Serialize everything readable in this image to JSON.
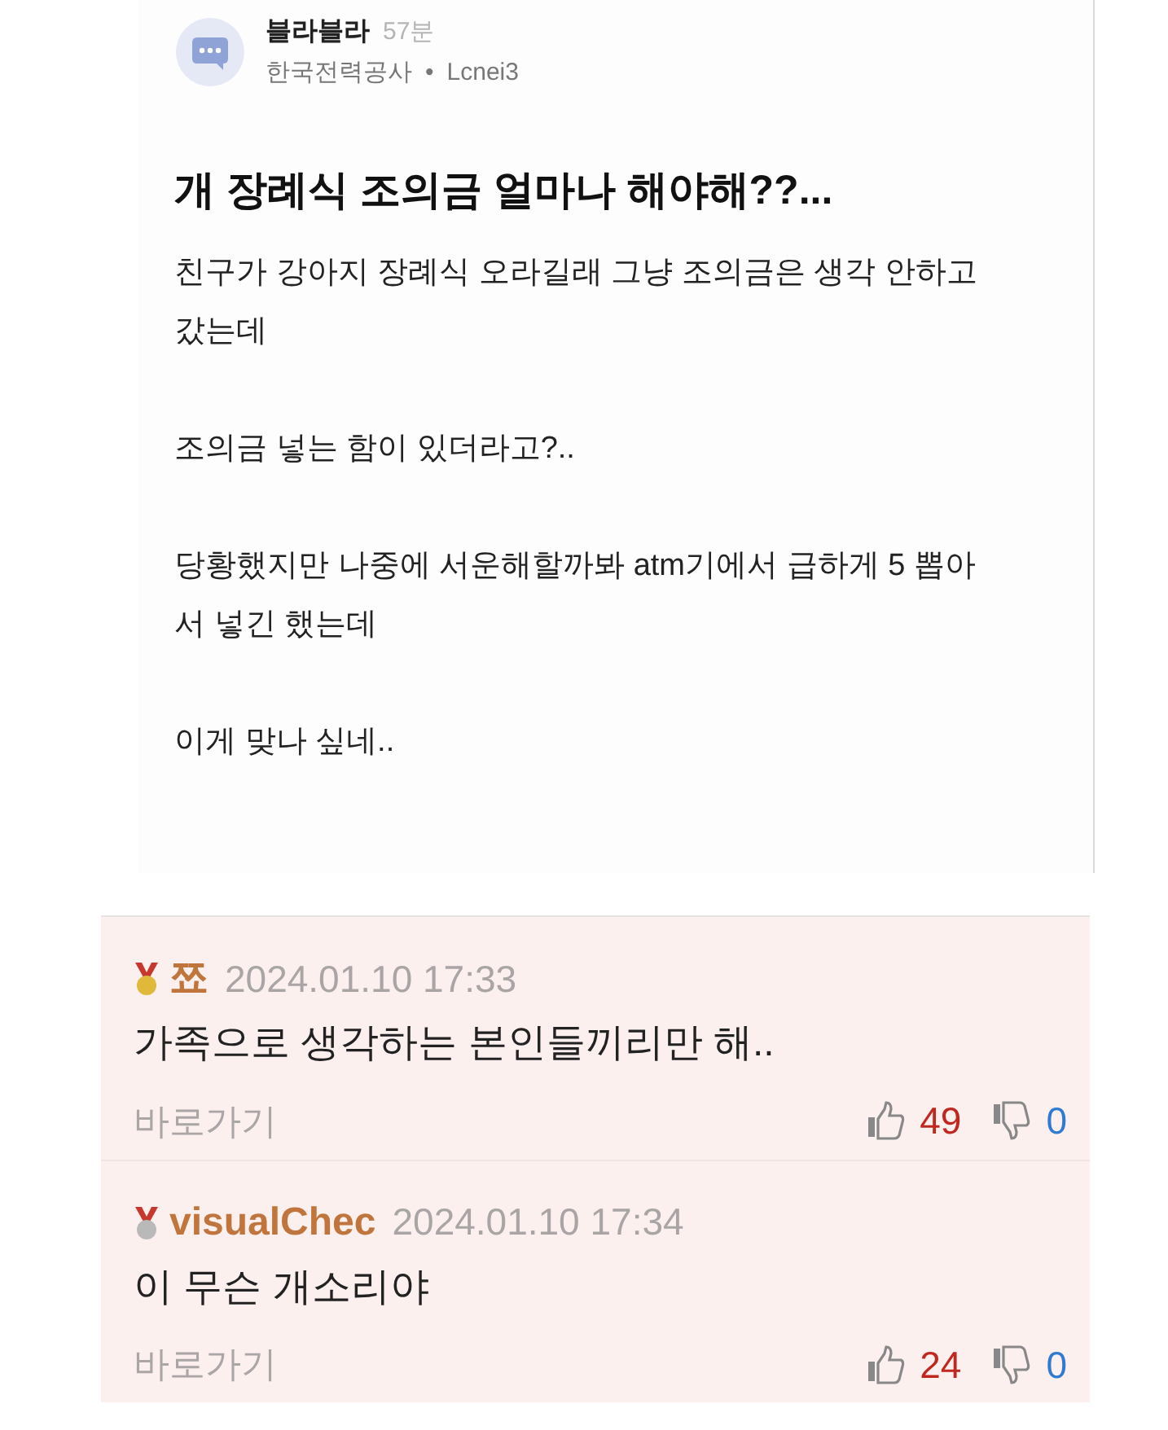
{
  "post": {
    "author": "블라블라",
    "time": "57분",
    "company": "한국전력공사",
    "separator": "•",
    "user_id": "Lcnei3",
    "title": "개 장례식 조의금 얼마나 해야해??...",
    "paragraphs": [
      "친구가 강아지 장례식 오라길래 그냥 조의금은 생각 안하고 갔는데",
      "조의금 넣는 함이 있더라고?..",
      "당황했지만 나중에 서운해할까봐 atm기에서 급하게 5 뽑아서 넣긴 했는데",
      "이게 맞나 싶네.."
    ]
  },
  "comments": [
    {
      "kind": "gold",
      "nickname": "쬬",
      "date": "2024.01.10 17:33",
      "text": "가족으로 생각하는 본인들끼리만 해..",
      "link": "바로가기",
      "likes": "49",
      "dislikes": "0"
    },
    {
      "kind": "silver",
      "nickname": "visualChec",
      "date": "2024.01.10 17:34",
      "text": "이 무슨 개소리야",
      "link": "바로가기",
      "likes": "24",
      "dislikes": "0"
    }
  ]
}
